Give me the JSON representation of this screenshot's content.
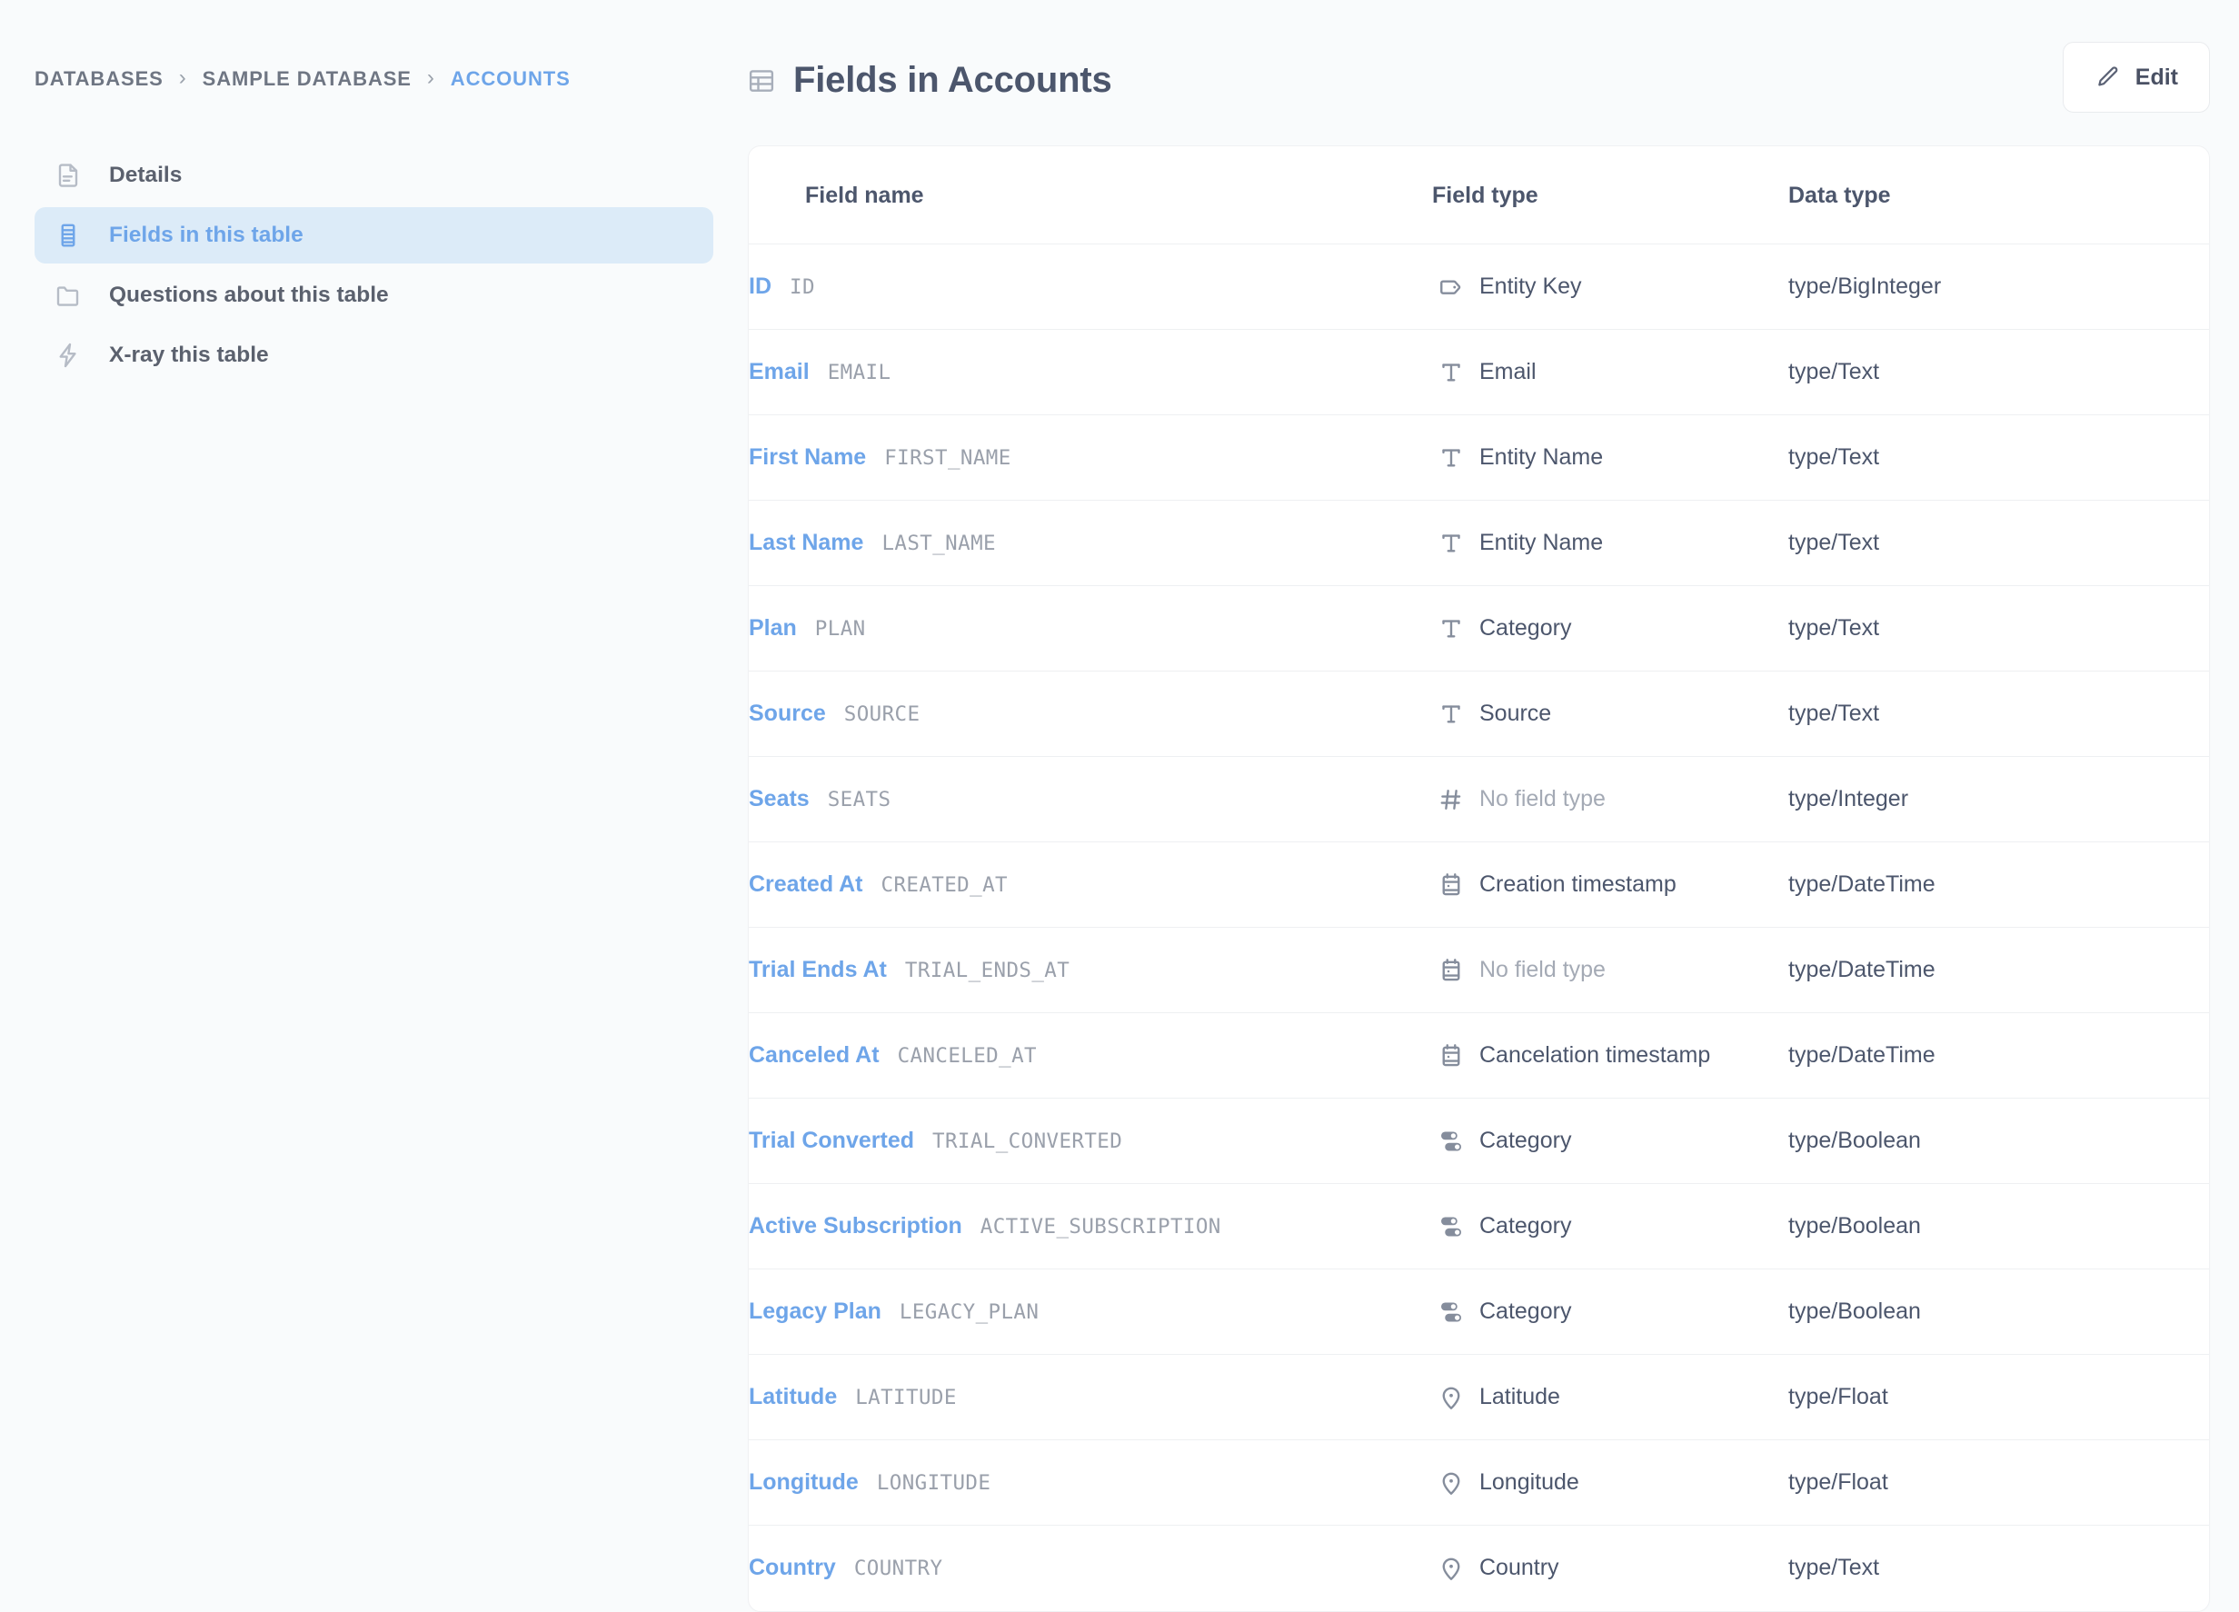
{
  "breadcrumb": {
    "items": [
      {
        "label": "DATABASES",
        "current": false
      },
      {
        "label": "SAMPLE DATABASE",
        "current": false
      },
      {
        "label": "ACCOUNTS",
        "current": true
      }
    ],
    "separator": "›"
  },
  "sidebar": {
    "items": [
      {
        "label": "Details",
        "icon": "document-icon",
        "active": false
      },
      {
        "label": "Fields in this table",
        "icon": "fields-list-icon",
        "active": true
      },
      {
        "label": "Questions about this table",
        "icon": "folder-icon",
        "active": false
      },
      {
        "label": "X-ray this table",
        "icon": "bolt-icon",
        "active": false
      }
    ]
  },
  "header": {
    "title": "Fields in Accounts",
    "title_icon": "table-grid-icon",
    "edit_label": "Edit",
    "edit_icon": "pencil-icon"
  },
  "table": {
    "columns": {
      "field_name": "Field name",
      "field_type": "Field type",
      "data_type": "Data type"
    },
    "rows": [
      {
        "display_name": "ID",
        "raw_name": "ID",
        "field_type": "Entity Key",
        "field_type_icon": "tag-icon",
        "field_type_empty": false,
        "data_type": "type/BigInteger"
      },
      {
        "display_name": "Email",
        "raw_name": "EMAIL",
        "field_type": "Email",
        "field_type_icon": "text-t-icon",
        "field_type_empty": false,
        "data_type": "type/Text"
      },
      {
        "display_name": "First Name",
        "raw_name": "FIRST_NAME",
        "field_type": "Entity Name",
        "field_type_icon": "text-t-icon",
        "field_type_empty": false,
        "data_type": "type/Text"
      },
      {
        "display_name": "Last Name",
        "raw_name": "LAST_NAME",
        "field_type": "Entity Name",
        "field_type_icon": "text-t-icon",
        "field_type_empty": false,
        "data_type": "type/Text"
      },
      {
        "display_name": "Plan",
        "raw_name": "PLAN",
        "field_type": "Category",
        "field_type_icon": "text-t-icon",
        "field_type_empty": false,
        "data_type": "type/Text"
      },
      {
        "display_name": "Source",
        "raw_name": "SOURCE",
        "field_type": "Source",
        "field_type_icon": "text-t-icon",
        "field_type_empty": false,
        "data_type": "type/Text"
      },
      {
        "display_name": "Seats",
        "raw_name": "SEATS",
        "field_type": "No field type",
        "field_type_icon": "hash-icon",
        "field_type_empty": true,
        "data_type": "type/Integer"
      },
      {
        "display_name": "Created At",
        "raw_name": "CREATED_AT",
        "field_type": "Creation timestamp",
        "field_type_icon": "calendar-icon",
        "field_type_empty": false,
        "data_type": "type/DateTime"
      },
      {
        "display_name": "Trial Ends At",
        "raw_name": "TRIAL_ENDS_AT",
        "field_type": "No field type",
        "field_type_icon": "calendar-icon",
        "field_type_empty": true,
        "data_type": "type/DateTime"
      },
      {
        "display_name": "Canceled At",
        "raw_name": "CANCELED_AT",
        "field_type": "Cancelation timestamp",
        "field_type_icon": "calendar-icon",
        "field_type_empty": false,
        "data_type": "type/DateTime"
      },
      {
        "display_name": "Trial Converted",
        "raw_name": "TRIAL_CONVERTED",
        "field_type": "Category",
        "field_type_icon": "toggles-icon",
        "field_type_empty": false,
        "data_type": "type/Boolean"
      },
      {
        "display_name": "Active Subscription",
        "raw_name": "ACTIVE_SUBSCRIPTION",
        "field_type": "Category",
        "field_type_icon": "toggles-icon",
        "field_type_empty": false,
        "data_type": "type/Boolean"
      },
      {
        "display_name": "Legacy Plan",
        "raw_name": "LEGACY_PLAN",
        "field_type": "Category",
        "field_type_icon": "toggles-icon",
        "field_type_empty": false,
        "data_type": "type/Boolean"
      },
      {
        "display_name": "Latitude",
        "raw_name": "LATITUDE",
        "field_type": "Latitude",
        "field_type_icon": "pin-icon",
        "field_type_empty": false,
        "data_type": "type/Float"
      },
      {
        "display_name": "Longitude",
        "raw_name": "LONGITUDE",
        "field_type": "Longitude",
        "field_type_icon": "pin-icon",
        "field_type_empty": false,
        "data_type": "type/Float"
      },
      {
        "display_name": "Country",
        "raw_name": "COUNTRY",
        "field_type": "Country",
        "field_type_icon": "pin-icon",
        "field_type_empty": false,
        "data_type": "type/Text"
      }
    ]
  },
  "colors": {
    "accent_blue": "#6ea5e9",
    "active_pill_bg": "#dcebf8",
    "text_dark": "#4c566c",
    "text_muted": "#9aa0ab",
    "page_bg": "#f9fbfc",
    "card_bg": "#ffffff",
    "row_border": "#eef0f2"
  }
}
